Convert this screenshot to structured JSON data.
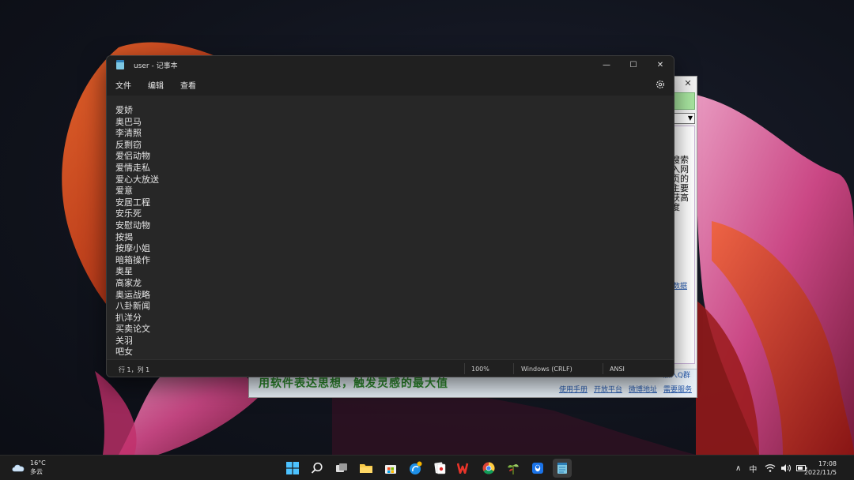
{
  "notepad": {
    "title": "user - 记事本",
    "controls": {
      "minimize": "—",
      "maximize": "☐",
      "close": "✕"
    },
    "menu": [
      "文件",
      "编辑",
      "查看"
    ],
    "lines": [
      "爱娇",
      "奥巴马",
      "李清照",
      "反剽窃",
      "爱侣动物",
      "爱情走私",
      "爱心大放送",
      "爱意",
      "安居工程",
      "安乐死",
      "安慰动物",
      "按揭",
      "按摩小姐",
      "暗箱操作",
      "奥星",
      "高家龙",
      "奥运战略",
      "八卦新闻",
      "扒洋分",
      "买卖论文",
      "关羽",
      "吧女"
    ],
    "status": {
      "position": "行 1，列 1",
      "zoom": "100%",
      "line_ending": "Windows (CRLF)",
      "encoding": "ANSI"
    }
  },
  "background_window": {
    "close": "✕",
    "dropdown_arrow": "▼",
    "side_text": "搜索入网页的主要获高度",
    "side_link": "数据",
    "slogan": "用软件表达思想，触发灵感的最大值",
    "links_row1": "加入Q群",
    "links_row2": [
      "使用手册",
      "开放平台",
      "微博地址",
      "需要服务"
    ]
  },
  "taskbar": {
    "weather_temp": "16°C",
    "weather_desc": "多云",
    "apps": [
      "start",
      "search",
      "task-view",
      "file-explorer",
      "store",
      "edge-browser",
      "solitaire",
      "wps-office",
      "chrome",
      "plant-app",
      "qq",
      "notepad"
    ],
    "tray": {
      "chevron": "∧",
      "ime": "中"
    },
    "time": "17:08",
    "date": "2022/11/5"
  }
}
